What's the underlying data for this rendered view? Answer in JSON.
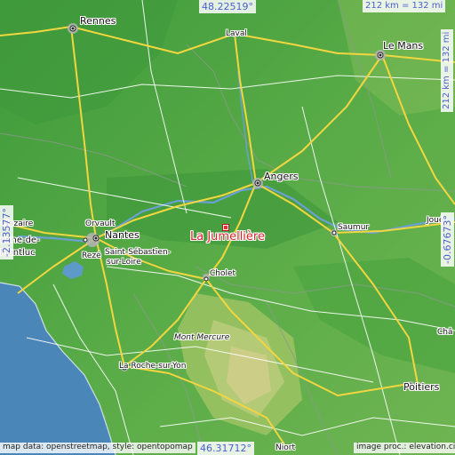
{
  "map": {
    "target_place": "La Jumellière",
    "colors": {
      "target": "#d7232c",
      "coordinate_text": "#4a5fd0"
    },
    "coordinates": {
      "lat_top": "48.22519°",
      "lat_bottom": "46.31712°",
      "lon_left": "-2.13577°",
      "lon_right": "-0.67673°"
    },
    "scale": {
      "horizontal": "212 km = 132 mi",
      "vertical": "212 km = 132 mi"
    },
    "attribution": {
      "left": "map data: openstreetmap, style: opentopomap",
      "right": "image proc.: elevation.city"
    },
    "places": {
      "rennes": "Rennes",
      "laval": "Laval",
      "le_mans": "Le Mans",
      "angers": "Angers",
      "saumur": "Saumur",
      "joue": "Joué",
      "nazaire": "-Nazaire",
      "orvault": "Orvault",
      "nantes": "Nantes",
      "enne_de": "enne-de-",
      "montluc": "Montluc",
      "reze": "Rezé",
      "saint_sebastien": "Saint-Sébastien-",
      "sur_loire": "sur-Loire",
      "cholet": "Cholet",
      "mont_mercure": "Mont Mercure",
      "chat": "Châ",
      "la_roche": "La Roche-sur-Yon",
      "poitiers": "Poitiers",
      "niort": "Niort"
    },
    "icons": [
      "city-marker-icon",
      "location-marker-icon"
    ]
  }
}
